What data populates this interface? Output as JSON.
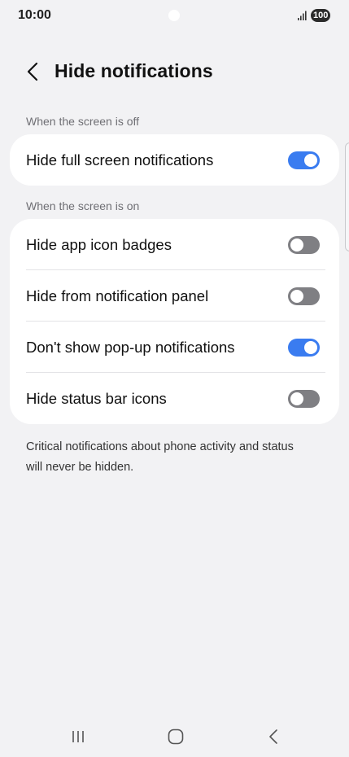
{
  "status_bar": {
    "time": "10:00",
    "battery": "100",
    "icons": [
      "signal-icon",
      "battery-icon"
    ]
  },
  "header": {
    "title": "Hide notifications",
    "back_icon": "chevron-left-icon"
  },
  "sections": [
    {
      "label": "When the screen is off",
      "items": [
        {
          "label": "Hide full screen notifications",
          "enabled": true
        }
      ]
    },
    {
      "label": "When the screen is on",
      "items": [
        {
          "label": "Hide app icon badges",
          "enabled": false
        },
        {
          "label": "Hide from notification panel",
          "enabled": false
        },
        {
          "label": "Don't show pop-up notifications",
          "enabled": true
        },
        {
          "label": "Hide status bar icons",
          "enabled": false
        }
      ]
    }
  ],
  "footnote": "Critical notifications about phone activity and status will never be hidden.",
  "nav_bar": {
    "buttons": [
      "recents-icon",
      "home-icon",
      "back-icon"
    ]
  },
  "colors": {
    "background": "#f2f2f4",
    "card": "#ffffff",
    "toggle_on": "#3a7cf0",
    "toggle_off": "#7f7f83"
  }
}
